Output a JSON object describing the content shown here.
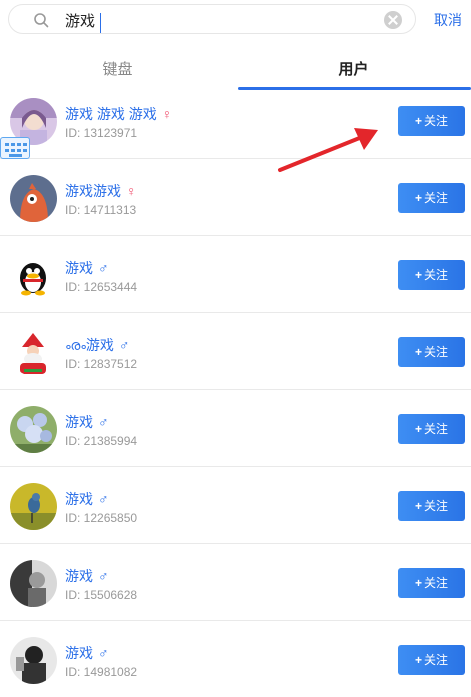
{
  "search": {
    "value": "游戏",
    "cancel_label": "取消"
  },
  "tabs": [
    {
      "label": "键盘",
      "active": false
    },
    {
      "label": "用户",
      "active": true
    }
  ],
  "follow_label": "关注",
  "accent_color": "#2b6fe8",
  "users": [
    {
      "name": "游戏 游戏 游戏",
      "gender": "♀",
      "id_text": "ID: 13123971"
    },
    {
      "name": "游戏游戏",
      "gender": "♀",
      "id_text": "ID: 14711313"
    },
    {
      "name": "游戏",
      "gender": "♂",
      "id_text": "ID: 12653444"
    },
    {
      "name": "ൟ游戏",
      "gender": "♂",
      "id_text": "ID: 12837512"
    },
    {
      "name": "游戏",
      "gender": "♂",
      "id_text": "ID: 21385994"
    },
    {
      "name": "游戏",
      "gender": "♂",
      "id_text": "ID: 12265850"
    },
    {
      "name": "游戏",
      "gender": "♂",
      "id_text": "ID: 15506628"
    },
    {
      "name": "游戏",
      "gender": "♂",
      "id_text": "ID: 14981082"
    }
  ]
}
